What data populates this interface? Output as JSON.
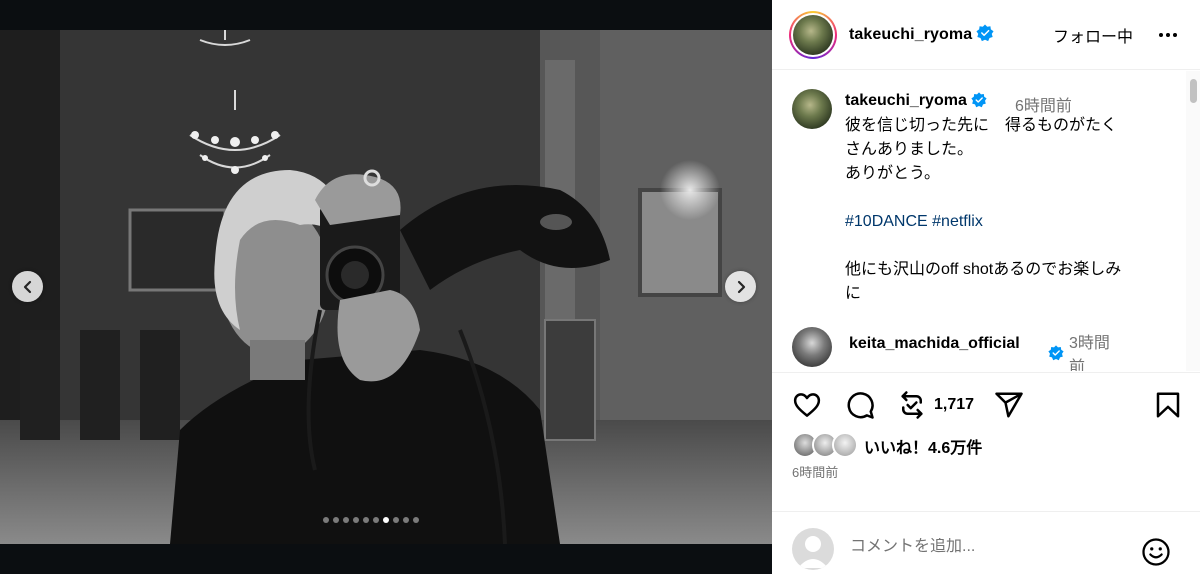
{
  "post": {
    "carousel": {
      "dot_count": 10,
      "active_index": 6
    }
  },
  "header": {
    "username": "takeuchi_ryoma",
    "follow_label": "フォロー中"
  },
  "caption": {
    "username": "takeuchi_ryoma",
    "time": "6時間前",
    "lines": [
      "彼を信じ切った先に　得るものがたく",
      "さんありました。",
      "ありがとう。"
    ],
    "hashtags": [
      "#10DANCE",
      "#netflix"
    ],
    "extra_lines": [
      "他にも沢山のoff shotあるのでお楽しみ",
      "に"
    ]
  },
  "comment": {
    "username": "keita_machida_officia l",
    "username_display": "keita_machida_official",
    "time": "3時間前"
  },
  "actions": {
    "repost_count": "1,717",
    "likes_text": "いいね！4.6万件",
    "post_time": "6時間前"
  },
  "add_comment": {
    "placeholder": "コメントを追加..."
  },
  "colors": {
    "verified": "#0095f6",
    "hashtag": "#00376b",
    "muted": "#737373"
  }
}
